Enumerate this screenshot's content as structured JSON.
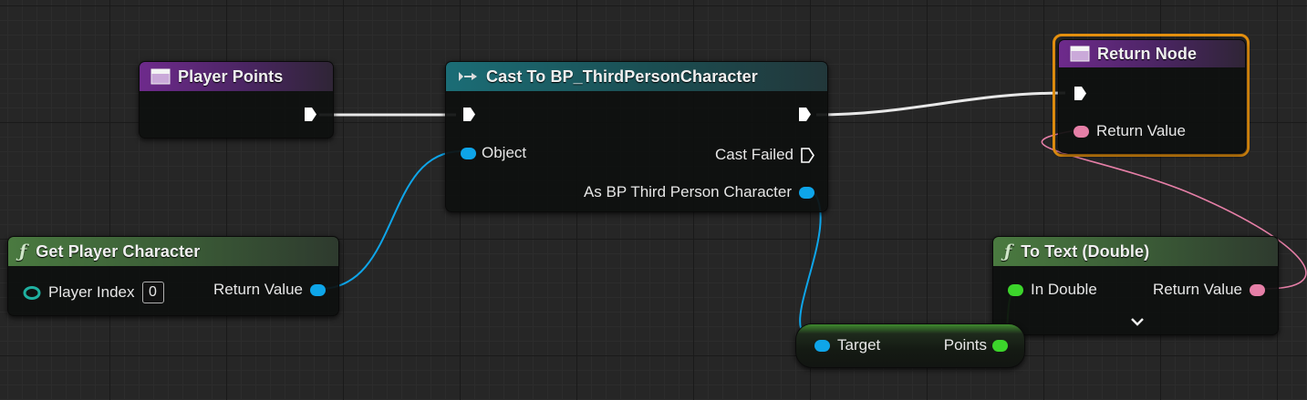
{
  "nodes": {
    "player_points": {
      "title": "Player Points"
    },
    "cast": {
      "title": "Cast To BP_ThirdPersonCharacter",
      "object_label": "Object",
      "cast_failed_label": "Cast Failed",
      "as_label": "As BP Third Person Character"
    },
    "return_node": {
      "title": "Return Node",
      "return_value_label": "Return Value"
    },
    "get_player_character": {
      "title": "Get Player Character",
      "player_index_label": "Player Index",
      "player_index_value": "0",
      "return_value_label": "Return Value"
    },
    "to_text": {
      "title": "To Text (Double)",
      "in_double_label": "In Double",
      "return_value_label": "Return Value"
    },
    "points_var": {
      "target_label": "Target",
      "points_label": "Points"
    }
  },
  "colors": {
    "exec": "#ffffff",
    "object_pin": "#0ea5e9",
    "text_pin": "#e67fa7",
    "double_pin": "#3cd52b",
    "int_pin": "#1fb0a0",
    "selection": "#e5900f"
  },
  "icons": [
    "function-icon",
    "event-icon",
    "cast-icon",
    "exec-pin-icon",
    "chevron-down-icon"
  ]
}
